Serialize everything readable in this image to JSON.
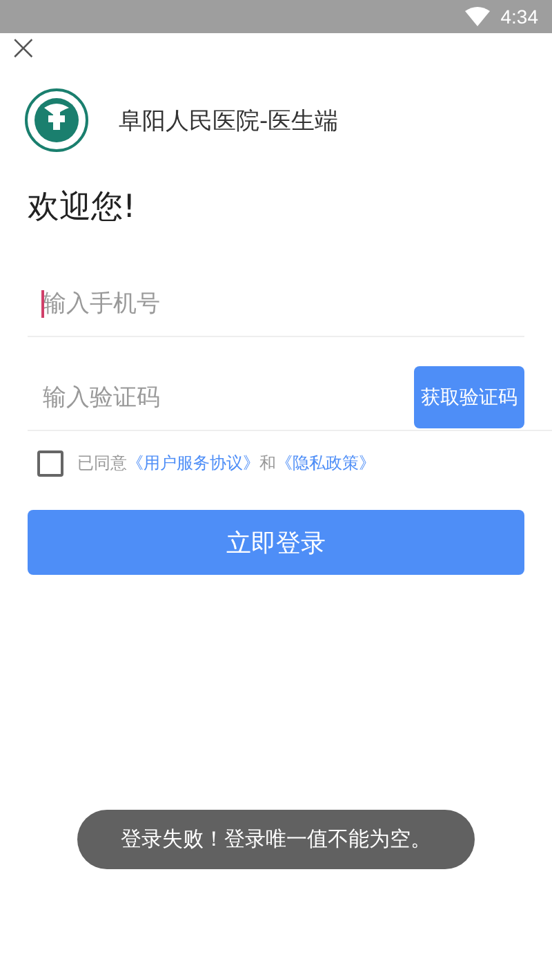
{
  "status_bar": {
    "time": "4:34"
  },
  "close": {
    "glyph": "×"
  },
  "header": {
    "app_name": "阜阳人民医院-医生端"
  },
  "greeting": "欢迎您!",
  "phone_field": {
    "placeholder": "输入手机号",
    "focused": true
  },
  "code_field": {
    "placeholder": "输入验证码",
    "button": "获取验证码"
  },
  "agreement": {
    "checked": false,
    "prefix": "已同意",
    "link_1": "《用户服务协议》",
    "joiner": "和",
    "link_2": "《隐私政策》"
  },
  "login_button": "立即登录",
  "toast": "登录失败！登录唯一值不能为空。"
}
